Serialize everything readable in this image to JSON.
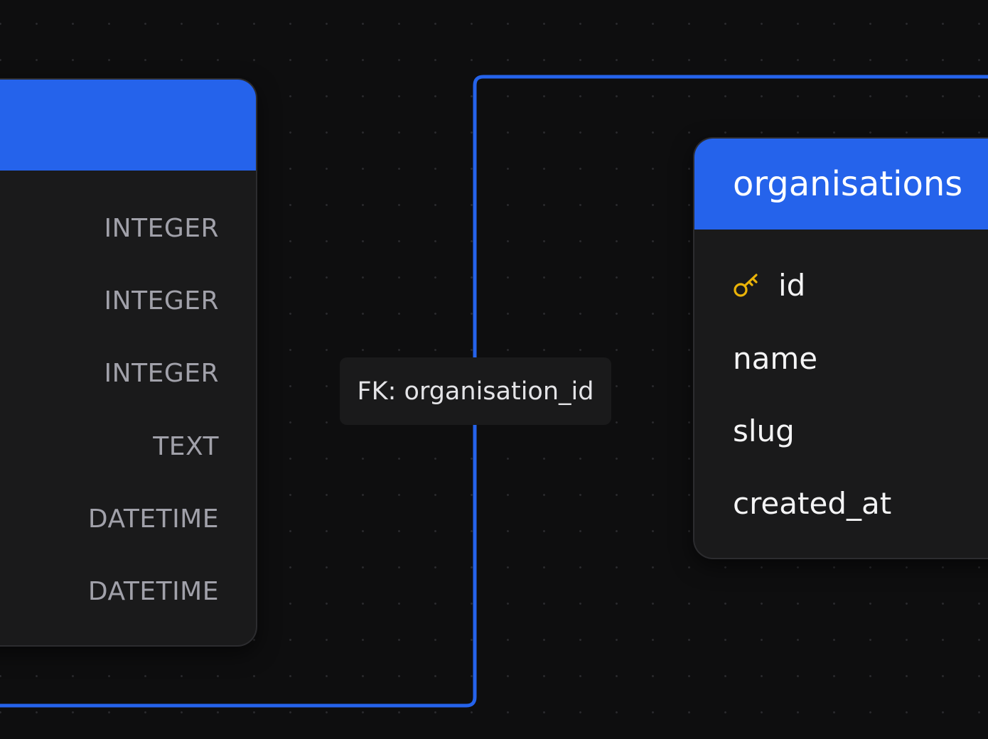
{
  "theme": {
    "accent": "#2563eb",
    "background": "#0e0e0f",
    "node_background": "#1a1a1b",
    "key_color": "#eab308"
  },
  "left_table": {
    "title": "",
    "column_types": [
      "INTEGER",
      "INTEGER",
      "INTEGER",
      "TEXT",
      "DATETIME",
      "DATETIME"
    ]
  },
  "right_table": {
    "title": "organisations",
    "columns": [
      {
        "name": "id",
        "icon": "key-icon",
        "primary_key": true
      },
      {
        "name": "name",
        "primary_key": false
      },
      {
        "name": "slug",
        "primary_key": false
      },
      {
        "name": "created_at",
        "primary_key": false
      }
    ]
  },
  "relationship": {
    "label": "FK: organisation_id"
  }
}
